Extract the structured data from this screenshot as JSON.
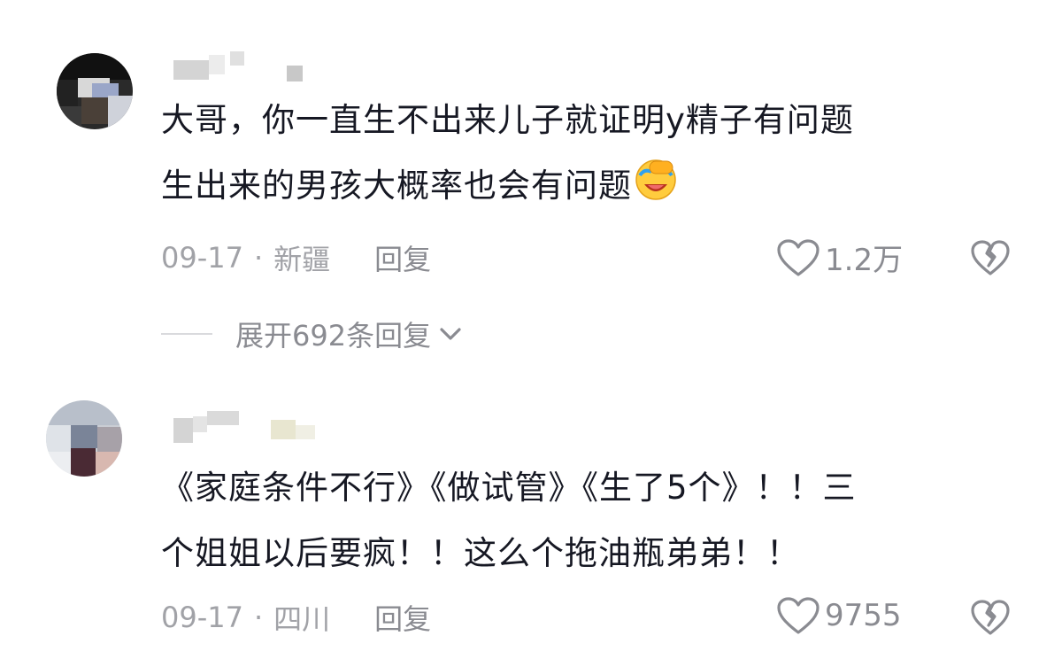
{
  "comments": [
    {
      "lines": [
        "大哥，你一直生不出来儿子就证明y精子有问题",
        "生出来的男孩大概率也会有问题"
      ],
      "emoji": "facepalm-laugh-emoji",
      "date": "09-17",
      "separator": "·",
      "location": "新疆",
      "reply_label": "回复",
      "likes": "1.2万",
      "expand_label": "展开692条回复"
    },
    {
      "lines": [
        "《家庭条件不行》《做试管》《生了5个》！！三",
        "个姐姐以后要疯！！这么个拖油瓶弟弟！！"
      ],
      "date": "09-17",
      "separator": "·",
      "location": "四川",
      "reply_label": "回复",
      "likes": "9755"
    }
  ],
  "icons": {
    "like": "heart-outline-icon",
    "dislike": "broken-heart-icon",
    "expand": "chevron-down-icon"
  },
  "colors": {
    "text": "#161823",
    "meta": "#a1a2a7",
    "secondary": "#8a8b91"
  }
}
